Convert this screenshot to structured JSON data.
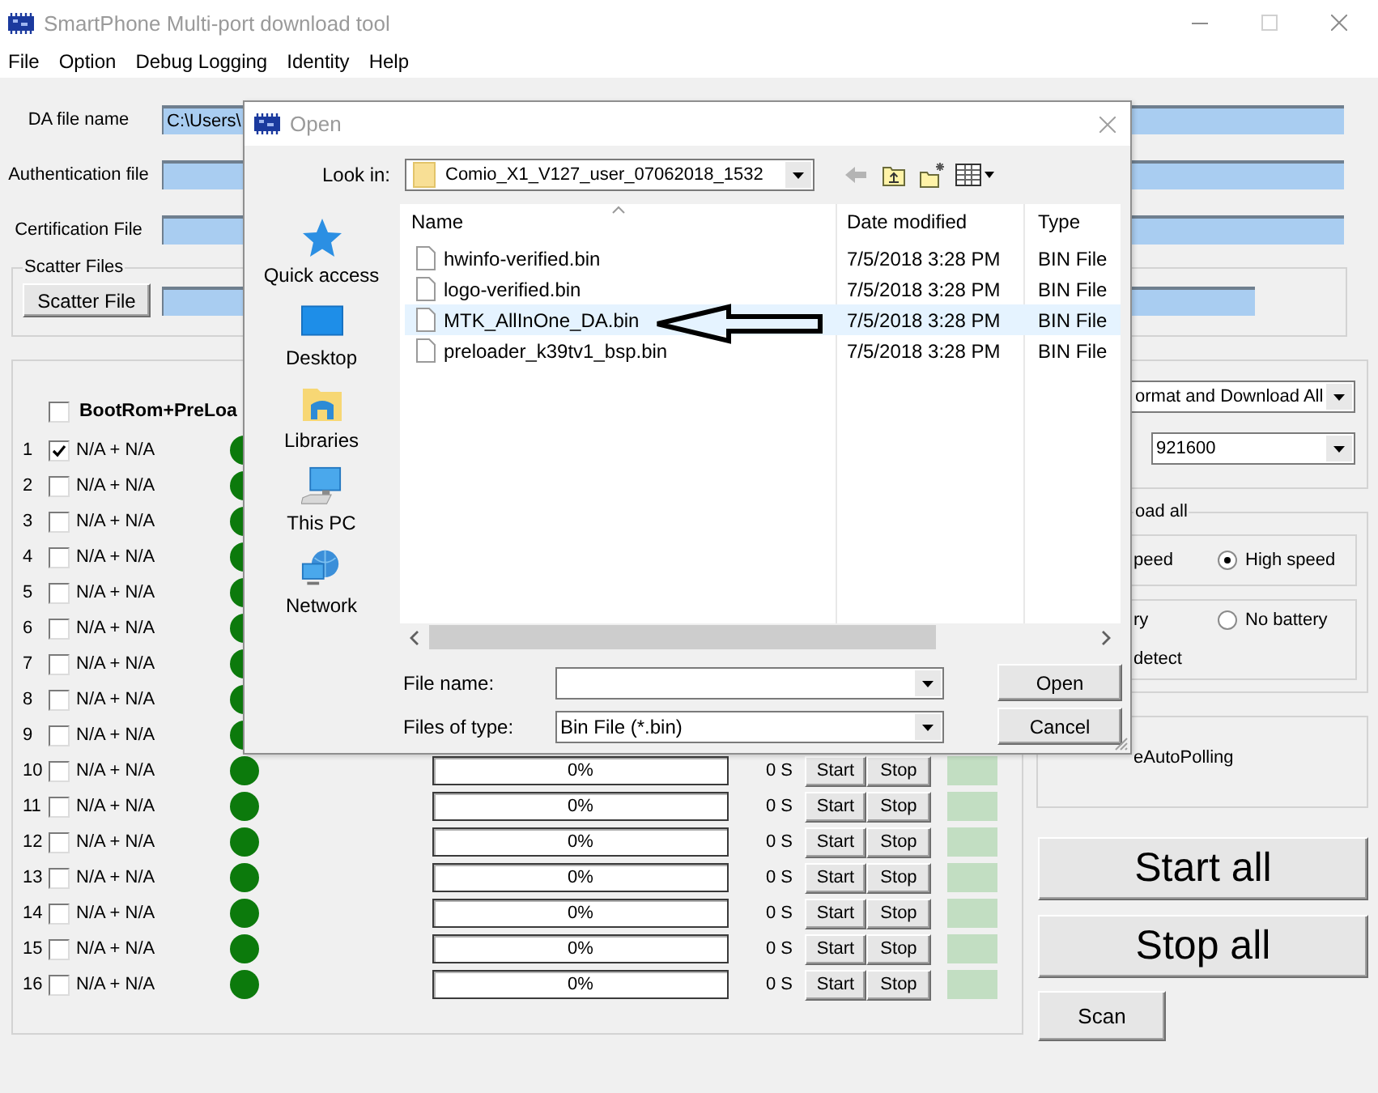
{
  "window": {
    "title": "SmartPhone Multi-port download tool"
  },
  "menu": [
    {
      "label": "File"
    },
    {
      "label": "Option"
    },
    {
      "label": "Debug Logging"
    },
    {
      "label": "Identity"
    },
    {
      "label": "Help"
    }
  ],
  "file_fields": [
    {
      "label": "DA file name",
      "value": "C:\\Users\\"
    },
    {
      "label": "Authentication file"
    },
    {
      "label": "Certification File"
    }
  ],
  "scatter": {
    "title": "Scatter Files",
    "button": "Scatter File"
  },
  "ports": {
    "header": {
      "label": "BootRom+PreLoa",
      "checked": false
    },
    "rows": [
      {
        "number": "1",
        "checked": true,
        "label": "N/A + N/A",
        "color": "#0c7a0c"
      },
      {
        "number": "2",
        "checked": false,
        "label": "N/A + N/A",
        "color": "#0c7a0c"
      },
      {
        "number": "3",
        "checked": false,
        "label": "N/A + N/A",
        "color": "#0c7a0c"
      },
      {
        "number": "4",
        "checked": false,
        "label": "N/A + N/A",
        "color": "#0c7a0c"
      },
      {
        "number": "5",
        "checked": false,
        "label": "N/A + N/A",
        "color": "#0c7a0c"
      },
      {
        "number": "6",
        "checked": false,
        "label": "N/A + N/A",
        "color": "#0c7a0c"
      },
      {
        "number": "7",
        "checked": false,
        "label": "N/A + N/A",
        "color": "#0c7a0c"
      },
      {
        "number": "8",
        "checked": false,
        "label": "N/A + N/A",
        "color": "#0c7a0c"
      },
      {
        "number": "9",
        "checked": false,
        "label": "N/A + N/A",
        "color": "#0c7a0c"
      },
      {
        "number": "10",
        "checked": false,
        "label": "N/A + N/A",
        "color": "#0c7a0c",
        "progress": "0%",
        "level": 0,
        "time": "0 S",
        "start": "Start",
        "stop": "Stop"
      },
      {
        "number": "11",
        "checked": false,
        "label": "N/A + N/A",
        "color": "#0c7a0c",
        "progress": "0%",
        "level": 0,
        "time": "0 S",
        "start": "Start",
        "stop": "Stop"
      },
      {
        "number": "12",
        "checked": false,
        "label": "N/A + N/A",
        "color": "#0c7a0c",
        "progress": "0%",
        "level": 0,
        "time": "0 S",
        "start": "Start",
        "stop": "Stop"
      },
      {
        "number": "13",
        "checked": false,
        "label": "N/A + N/A",
        "color": "#0c7a0c",
        "progress": "0%",
        "level": 0,
        "time": "0 S",
        "start": "Start",
        "stop": "Stop"
      },
      {
        "number": "14",
        "checked": false,
        "label": "N/A + N/A",
        "color": "#0c7a0c",
        "progress": "0%",
        "level": 0,
        "time": "0 S",
        "start": "Start",
        "stop": "Stop"
      },
      {
        "number": "15",
        "checked": false,
        "label": "N/A + N/A",
        "color": "#0c7a0c",
        "progress": "0%",
        "level": 0,
        "time": "0 S",
        "start": "Start",
        "stop": "Stop"
      },
      {
        "number": "16",
        "checked": false,
        "label": "N/A + N/A",
        "color": "#0c7a0c",
        "progress": "0%",
        "level": 0,
        "time": "0 S",
        "start": "Start",
        "stop": "Stop"
      }
    ]
  },
  "right_panel": {
    "mode_select": "ormat and Download All",
    "baud_select": "921600",
    "download_group": {
      "title": "oad all",
      "speed_options": [
        {
          "kind": "cut_label",
          "label": "peed"
        },
        {
          "kind": "radio",
          "label": "High speed",
          "selected": true
        }
      ],
      "battery_options": [
        {
          "kind": "cut_label",
          "label": "ry"
        },
        {
          "kind": "radio",
          "label": "No battery",
          "selected": false
        }
      ],
      "detect": "detect"
    },
    "polling_label": "eAutoPolling",
    "buttons": [
      {
        "kind": "large",
        "label": "Start all"
      },
      {
        "kind": "large",
        "label": "Stop all"
      },
      {
        "kind": "small",
        "label": "Scan"
      }
    ]
  },
  "open_dialog": {
    "title": "Open",
    "look_in": {
      "label": "Look in:",
      "value": "Comio_X1_V127_user_07062018_1532"
    },
    "places": [
      {
        "label": "Quick access"
      },
      {
        "label": "Desktop"
      },
      {
        "label": "Libraries"
      },
      {
        "label": "This PC"
      },
      {
        "label": "Network"
      }
    ],
    "columns": [
      "Name",
      "Date modified",
      "Type"
    ],
    "files": [
      {
        "name": "hwinfo-verified.bin",
        "date": "7/5/2018 3:28 PM",
        "type": "BIN File",
        "selected": false
      },
      {
        "name": "logo-verified.bin",
        "date": "7/5/2018 3:28 PM",
        "type": "BIN File",
        "selected": false
      },
      {
        "name": "MTK_AllInOne_DA.bin",
        "date": "7/5/2018 3:28 PM",
        "type": "BIN File",
        "selected": true
      },
      {
        "name": "preloader_k39tv1_bsp.bin",
        "date": "7/5/2018 3:28 PM",
        "type": "BIN File",
        "selected": false
      }
    ],
    "file_name": {
      "label": "File name:"
    },
    "file_type": {
      "label": "Files of type:",
      "value": "Bin File (*.bin)"
    },
    "buttons": [
      "Open",
      "Cancel"
    ]
  }
}
